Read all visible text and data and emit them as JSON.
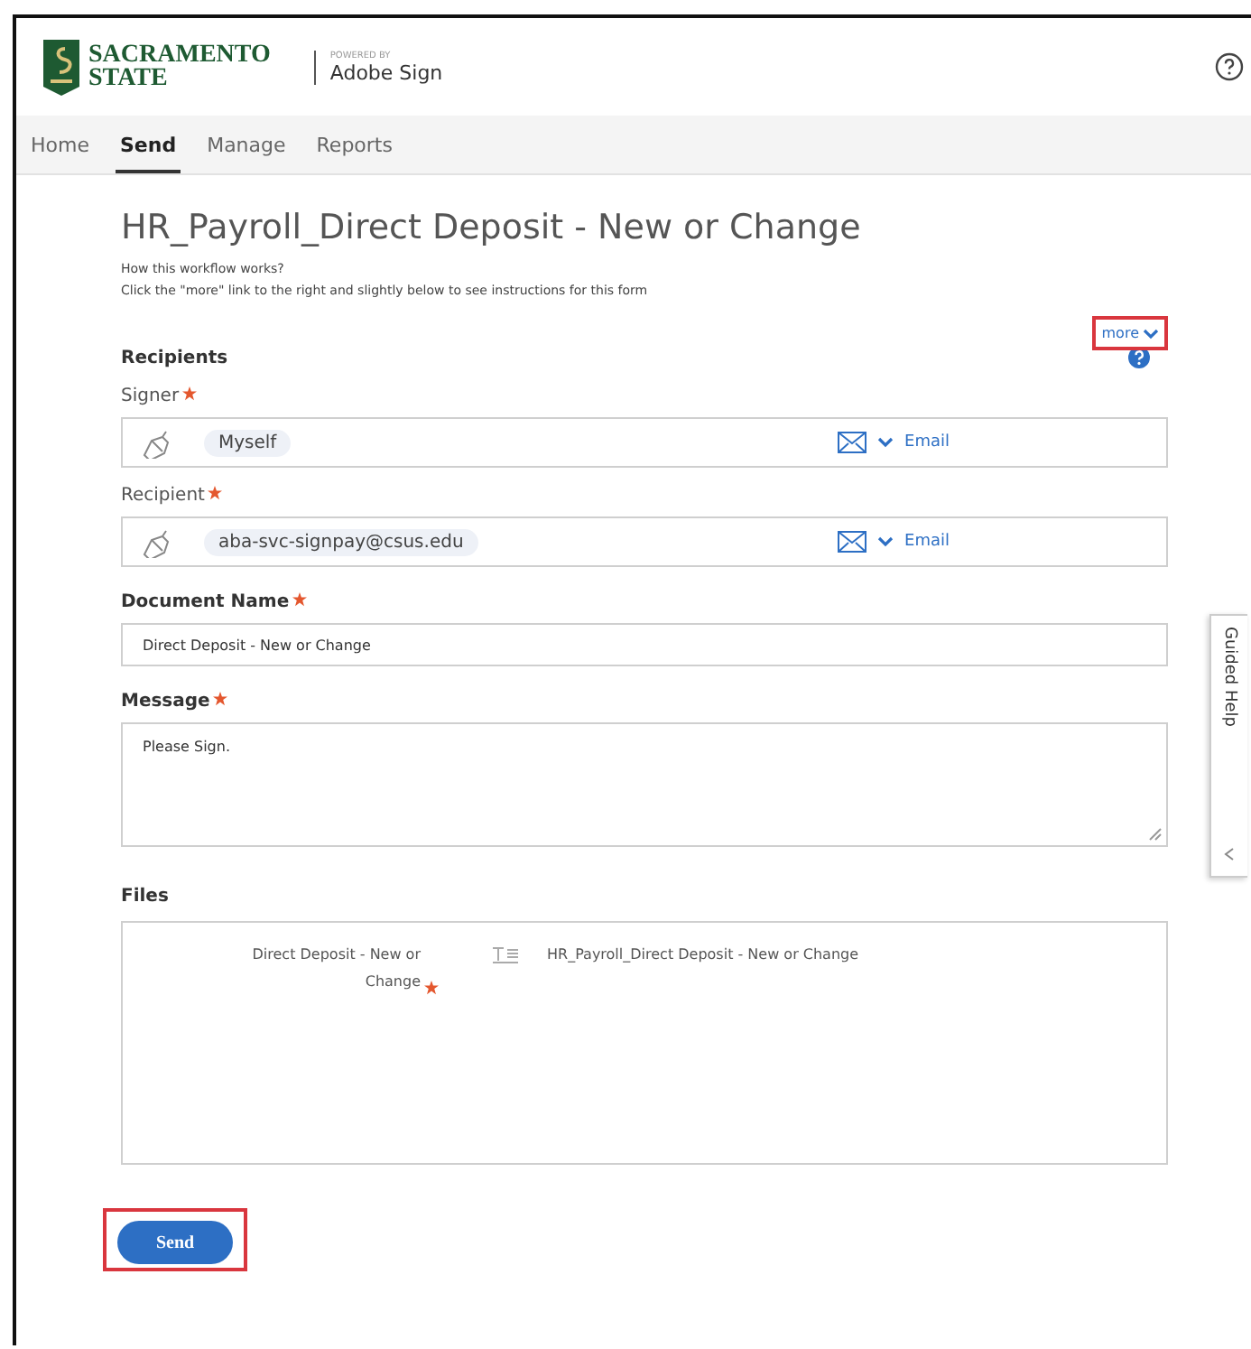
{
  "header": {
    "logo_line1": "SACRAMENTO",
    "logo_line2": "STATE",
    "powered_by": "POWERED BY",
    "product": "Adobe Sign"
  },
  "nav": {
    "tabs": [
      {
        "label": "Home",
        "selected": false
      },
      {
        "label": "Send",
        "selected": true
      },
      {
        "label": "Manage",
        "selected": false
      },
      {
        "label": "Reports",
        "selected": false
      }
    ]
  },
  "form": {
    "title": "HR_Payroll_Direct Deposit - New or Change",
    "intro": [
      "How this workflow works?",
      "Click the \"more\" link to the right and slightly below to see instructions for this form"
    ],
    "more_link": {
      "label": "more",
      "highlighted": true
    },
    "recipients_heading": "Recipients",
    "recipients": [
      {
        "label": "Signer",
        "required": true,
        "value": "Myself",
        "delivery": "Email"
      },
      {
        "label": "Recipient",
        "required": true,
        "value": "aba-svc-signpay@csus.edu",
        "delivery": "Email"
      }
    ],
    "document_name": {
      "label": "Document Name",
      "required": true,
      "value": "Direct Deposit - New or Change"
    },
    "message": {
      "label": "Message",
      "required": true,
      "value": "Please Sign."
    },
    "files": {
      "label": "Files",
      "file_label": "Direct Deposit - New or Change",
      "required": true,
      "file_name": "HR_Payroll_Direct Deposit - New or Change"
    },
    "send_button": {
      "label": "Send",
      "highlighted": true
    }
  },
  "guided_help": "Guided Help"
}
